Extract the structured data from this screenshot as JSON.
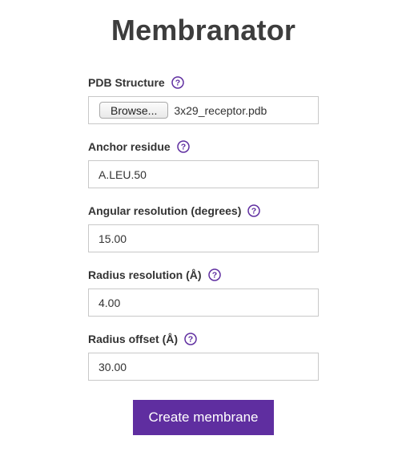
{
  "page": {
    "title": "Membranator"
  },
  "colors": {
    "accent": "#5f2ea0",
    "help_icon": "#5f2ea0",
    "input_border": "#c8c8c8"
  },
  "form": {
    "pdb_structure": {
      "label": "PDB Structure",
      "icon": "help-circle-icon",
      "browse_label": "Browse...",
      "file_name": "3x29_receptor.pdb"
    },
    "anchor_residue": {
      "label": "Anchor residue",
      "icon": "help-circle-icon",
      "value": "A.LEU.50"
    },
    "angular_resolution": {
      "label": "Angular resolution (degrees)",
      "icon": "help-circle-icon",
      "value": "15.00"
    },
    "radius_resolution": {
      "label": "Radius resolution (Å)",
      "icon": "help-circle-icon",
      "value": "4.00"
    },
    "radius_offset": {
      "label": "Radius offset (Å)",
      "icon": "help-circle-icon",
      "value": "30.00"
    },
    "submit_label": "Create membrane"
  }
}
